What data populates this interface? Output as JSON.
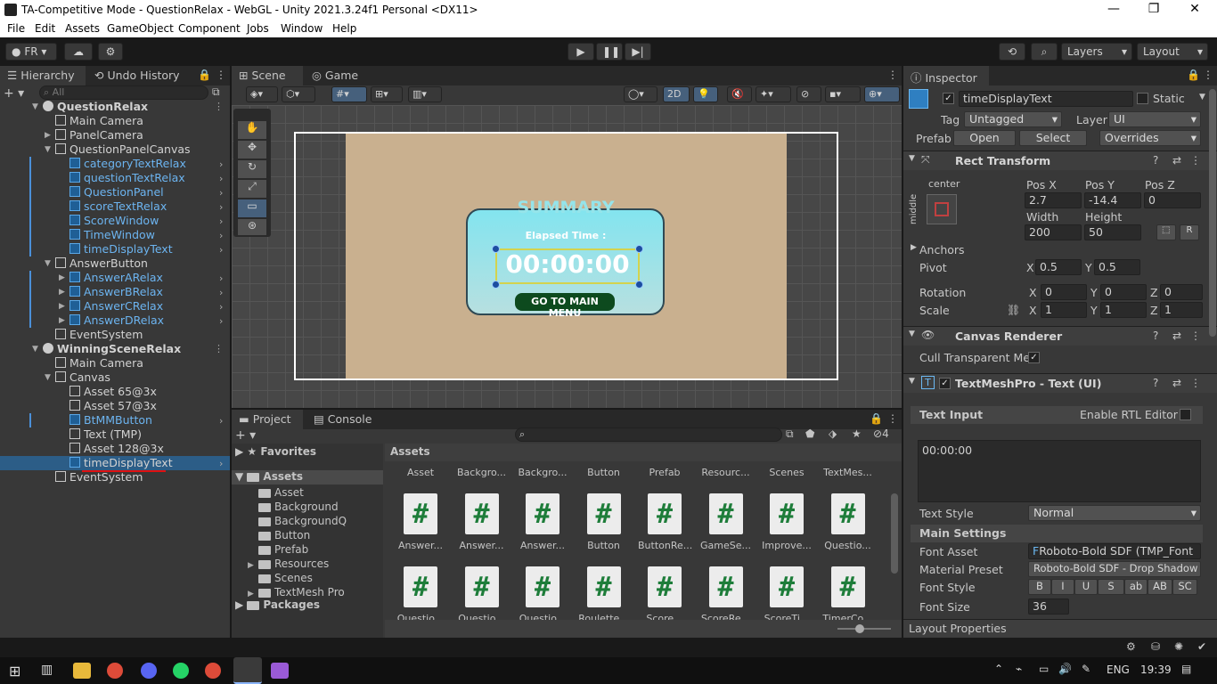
{
  "window": {
    "title": "TA-Competitive Mode - QuestionRelax - WebGL - Unity 2021.3.24f1 Personal <DX11>",
    "min": "—",
    "restore": "❐",
    "close": "✕"
  },
  "menu": [
    "File",
    "Edit",
    "Assets",
    "GameObject",
    "Component",
    "Jobs",
    "Window",
    "Help"
  ],
  "toolbar": {
    "account": "FR",
    "layers": "Layers",
    "layout": "Layout"
  },
  "hierarchy": {
    "tab": "Hierarchy",
    "tab2": "Undo History",
    "search_placeholder": "All",
    "rows": [
      {
        "label": "QuestionRelax",
        "indent": 0,
        "type": "scene",
        "arrow": "▼",
        "blue": false,
        "sel": false
      },
      {
        "label": "Main Camera",
        "indent": 1,
        "type": "obj",
        "arrow": "",
        "blue": false
      },
      {
        "label": "PanelCamera",
        "indent": 1,
        "type": "obj",
        "arrow": "▶",
        "blue": false
      },
      {
        "label": "QuestionPanelCanvas",
        "indent": 1,
        "type": "obj",
        "arrow": "▼",
        "blue": false
      },
      {
        "label": "categoryTextRelax",
        "indent": 2,
        "type": "prefab",
        "arrow": "",
        "blue": true,
        "more": true
      },
      {
        "label": "questionTextRelax",
        "indent": 2,
        "type": "prefab",
        "arrow": "",
        "blue": true,
        "more": true
      },
      {
        "label": "QuestionPanel",
        "indent": 2,
        "type": "prefab",
        "arrow": "",
        "blue": true,
        "more": true
      },
      {
        "label": "scoreTextRelax",
        "indent": 2,
        "type": "prefab",
        "arrow": "",
        "blue": true,
        "more": true
      },
      {
        "label": "ScoreWindow",
        "indent": 2,
        "type": "prefab",
        "arrow": "",
        "blue": true,
        "more": true
      },
      {
        "label": "TimeWindow",
        "indent": 2,
        "type": "prefab",
        "arrow": "",
        "blue": true,
        "more": true
      },
      {
        "label": "timeDisplayText",
        "indent": 2,
        "type": "prefab",
        "arrow": "",
        "blue": true,
        "more": true
      },
      {
        "label": "AnswerButton",
        "indent": 1,
        "type": "obj",
        "arrow": "▼",
        "blue": false
      },
      {
        "label": "AnswerARelax",
        "indent": 2,
        "type": "prefab",
        "arrow": "▶",
        "blue": true,
        "more": true
      },
      {
        "label": "AnswerBRelax",
        "indent": 2,
        "type": "prefab",
        "arrow": "▶",
        "blue": true,
        "more": true
      },
      {
        "label": "AnswerCRelax",
        "indent": 2,
        "type": "prefab",
        "arrow": "▶",
        "blue": true,
        "more": true
      },
      {
        "label": "AnswerDRelax",
        "indent": 2,
        "type": "prefab",
        "arrow": "▶",
        "blue": true,
        "more": true
      },
      {
        "label": "EventSystem",
        "indent": 1,
        "type": "obj",
        "arrow": "",
        "blue": false
      },
      {
        "label": "WinningSceneRelax",
        "indent": 0,
        "type": "scene",
        "arrow": "▼",
        "blue": false
      },
      {
        "label": "Main Camera",
        "indent": 1,
        "type": "obj",
        "arrow": "",
        "blue": false
      },
      {
        "label": "Canvas",
        "indent": 1,
        "type": "obj",
        "arrow": "▼",
        "blue": false
      },
      {
        "label": "Asset 65@3x",
        "indent": 2,
        "type": "obj",
        "arrow": "",
        "blue": false
      },
      {
        "label": "Asset 57@3x",
        "indent": 2,
        "type": "obj",
        "arrow": "",
        "blue": false
      },
      {
        "label": "BtMMButton",
        "indent": 2,
        "type": "prefab",
        "arrow": "",
        "blue": true,
        "more": true
      },
      {
        "label": "Text (TMP)",
        "indent": 2,
        "type": "obj",
        "arrow": "",
        "blue": false
      },
      {
        "label": "Asset 128@3x",
        "indent": 2,
        "type": "obj",
        "arrow": "",
        "blue": false
      },
      {
        "label": "timeDisplayText",
        "indent": 2,
        "type": "prefab",
        "arrow": "",
        "blue": false,
        "sel": true,
        "more": true
      },
      {
        "label": "EventSystem",
        "indent": 1,
        "type": "obj",
        "arrow": "",
        "blue": false
      }
    ]
  },
  "scene": {
    "tab": "Scene",
    "tab2": "Game",
    "mode2d": "2D",
    "summary": "SUMMARY",
    "elapsed": "Elapsed Time :",
    "time": "00:00:00",
    "mainmenu": "GO TO MAIN MENU"
  },
  "project": {
    "tab": "Project",
    "tab2": "Console",
    "favorites": "Favorites",
    "assets_root": "Assets",
    "packages": "Packages",
    "hidden_count": "4",
    "folders": [
      "Asset",
      "Background",
      "BackgroundQ",
      "Button",
      "Prefab",
      "Resources",
      "Scenes",
      "TextMesh Pro"
    ],
    "breadcrumb": "Assets",
    "grid_folders": [
      "Asset",
      "Backgro...",
      "Backgro...",
      "Button",
      "Prefab",
      "Resourc...",
      "Scenes",
      "TextMes..."
    ],
    "row1": [
      "Answer...",
      "Answer...",
      "Answer...",
      "Button",
      "ButtonRe...",
      "GameSe...",
      "Improve...",
      "Questio..."
    ],
    "row2": [
      "Questio...",
      "Questio...",
      "Questio...",
      "Roulette...",
      "Score...",
      "ScoreRe...",
      "ScoreTi...",
      "TimerCo..."
    ],
    "script_glyph": "#"
  },
  "inspector": {
    "tab": "Inspector",
    "name": "timeDisplayText",
    "static": "Static",
    "tag_label": "Tag",
    "tag": "Untagged",
    "layer_label": "Layer",
    "layer": "UI",
    "prefab_label": "Prefab",
    "open": "Open",
    "select": "Select",
    "overrides": "Overrides",
    "rect_title": "Rect Transform",
    "anchor_h": "center",
    "anchor_v": "middle",
    "posx_l": "Pos X",
    "posy_l": "Pos Y",
    "posz_l": "Pos Z",
    "posx": "2.7",
    "posy": "-14.4",
    "posz": "0",
    "width_l": "Width",
    "height_l": "Height",
    "width": "200",
    "height": "50",
    "r": "R",
    "anchors": "Anchors",
    "pivot": "Pivot",
    "pivot_x": "0.5",
    "pivot_y": "0.5",
    "rotation": "Rotation",
    "rot_x": "0",
    "rot_y": "0",
    "rot_z": "0",
    "scale": "Scale",
    "scale_x": "1",
    "scale_y": "1",
    "scale_z": "1",
    "x": "X",
    "y": "Y",
    "z": "Z",
    "canvas_renderer": "Canvas Renderer",
    "cull": "Cull Transparent Mes",
    "tmp_title": "TextMeshPro - Text (UI)",
    "text_input": "Text Input",
    "rtl": "Enable RTL Editor",
    "text_value": "00:00:00",
    "text_style_l": "Text Style",
    "text_style": "Normal",
    "main_settings": "Main Settings",
    "font_asset_l": "Font Asset",
    "font_asset": "Roboto-Bold SDF (TMP_Font",
    "material_l": "Material Preset",
    "material": "Roboto-Bold SDF - Drop Shadow",
    "font_style_l": "Font Style",
    "styles": [
      "B",
      "I",
      "U",
      "S",
      "ab",
      "AB",
      "SC"
    ],
    "font_size_l": "Font Size",
    "font_size": "36",
    "layout_props": "Layout Properties"
  },
  "taskbar": {
    "lang": "ENG",
    "time": "19:39"
  }
}
